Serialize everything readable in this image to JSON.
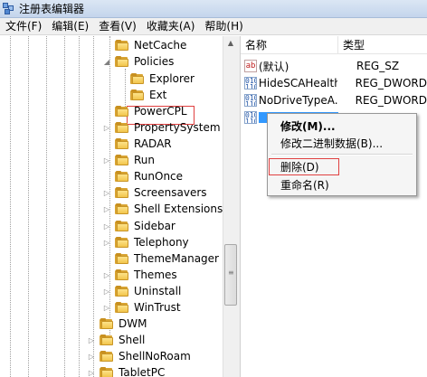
{
  "window": {
    "title": "注册表编辑器"
  },
  "menu": [
    "文件(F)",
    "编辑(E)",
    "查看(V)",
    "收藏夹(A)",
    "帮助(H)"
  ],
  "tree": {
    "items": [
      {
        "label": "NetCache",
        "expander": ""
      },
      {
        "label": "Policies",
        "expander": "expanded"
      },
      {
        "label": "Explorer",
        "expander": "",
        "selected": true
      },
      {
        "label": "Ext",
        "expander": ""
      },
      {
        "label": "PowerCPL",
        "expander": ""
      },
      {
        "label": "PropertySystem",
        "expander": "collapsed"
      },
      {
        "label": "RADAR",
        "expander": ""
      },
      {
        "label": "Run",
        "expander": "collapsed"
      },
      {
        "label": "RunOnce",
        "expander": ""
      },
      {
        "label": "Screensavers",
        "expander": "collapsed"
      },
      {
        "label": "Shell Extensions",
        "expander": "collapsed"
      },
      {
        "label": "Sidebar",
        "expander": "collapsed"
      },
      {
        "label": "Telephony",
        "expander": "collapsed"
      },
      {
        "label": "ThemeManager",
        "expander": ""
      },
      {
        "label": "Themes",
        "expander": "collapsed"
      },
      {
        "label": "Uninstall",
        "expander": "collapsed"
      },
      {
        "label": "WinTrust",
        "expander": "collapsed"
      },
      {
        "label": "DWM",
        "expander": ""
      },
      {
        "label": "Shell",
        "expander": "collapsed"
      },
      {
        "label": "ShellNoRoam",
        "expander": "collapsed"
      },
      {
        "label": "TabletPC",
        "expander": "collapsed"
      }
    ]
  },
  "values": {
    "headers": {
      "name": "名称",
      "type": "类型"
    },
    "rows": [
      {
        "icon": "string-value-icon",
        "name": "(默认)",
        "type": "REG_SZ"
      },
      {
        "icon": "dword-value-icon",
        "name": "HideSCAHealth",
        "type": "REG_DWORD"
      },
      {
        "icon": "dword-value-icon",
        "name": "NoDriveTypeA...",
        "type": "REG_DWORD"
      }
    ]
  },
  "context_menu": {
    "modify": "修改(M)...",
    "modify_binary": "修改二进制数据(B)...",
    "delete": "删除(D)",
    "rename": "重命名(R)"
  },
  "colors": {
    "selection": "#3399ff",
    "highlight_border": "#e04040"
  }
}
